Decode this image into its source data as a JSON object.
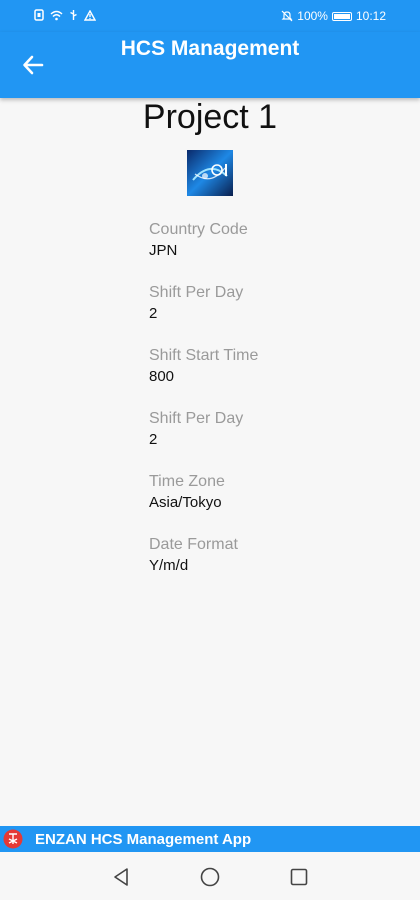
{
  "status_bar": {
    "battery_percent": "100%",
    "time": "10:12",
    "icons": [
      "sim-icon",
      "wifi-icon",
      "usb-icon",
      "warning-icon",
      "mute-icon",
      "battery-icon"
    ]
  },
  "app_bar": {
    "title": "HCS Management",
    "back_icon": "back-arrow-icon"
  },
  "project": {
    "title": "Project 1"
  },
  "fields": [
    {
      "label": "Country Code",
      "value": "JPN"
    },
    {
      "label": "Shift Per Day",
      "value": "2"
    },
    {
      "label": "Shift Start Time",
      "value": "800"
    },
    {
      "label": "Shift Per Day",
      "value": "2"
    },
    {
      "label": "Time Zone",
      "value": "Asia/Tokyo"
    },
    {
      "label": "Date Format",
      "value": "Y/m/d"
    }
  ],
  "footer": {
    "text": "ENZAN HCS Management App"
  },
  "colors": {
    "primary": "#2196f3",
    "background": "#f7f7f7",
    "label": "#9a9a9a",
    "value": "#111111"
  }
}
